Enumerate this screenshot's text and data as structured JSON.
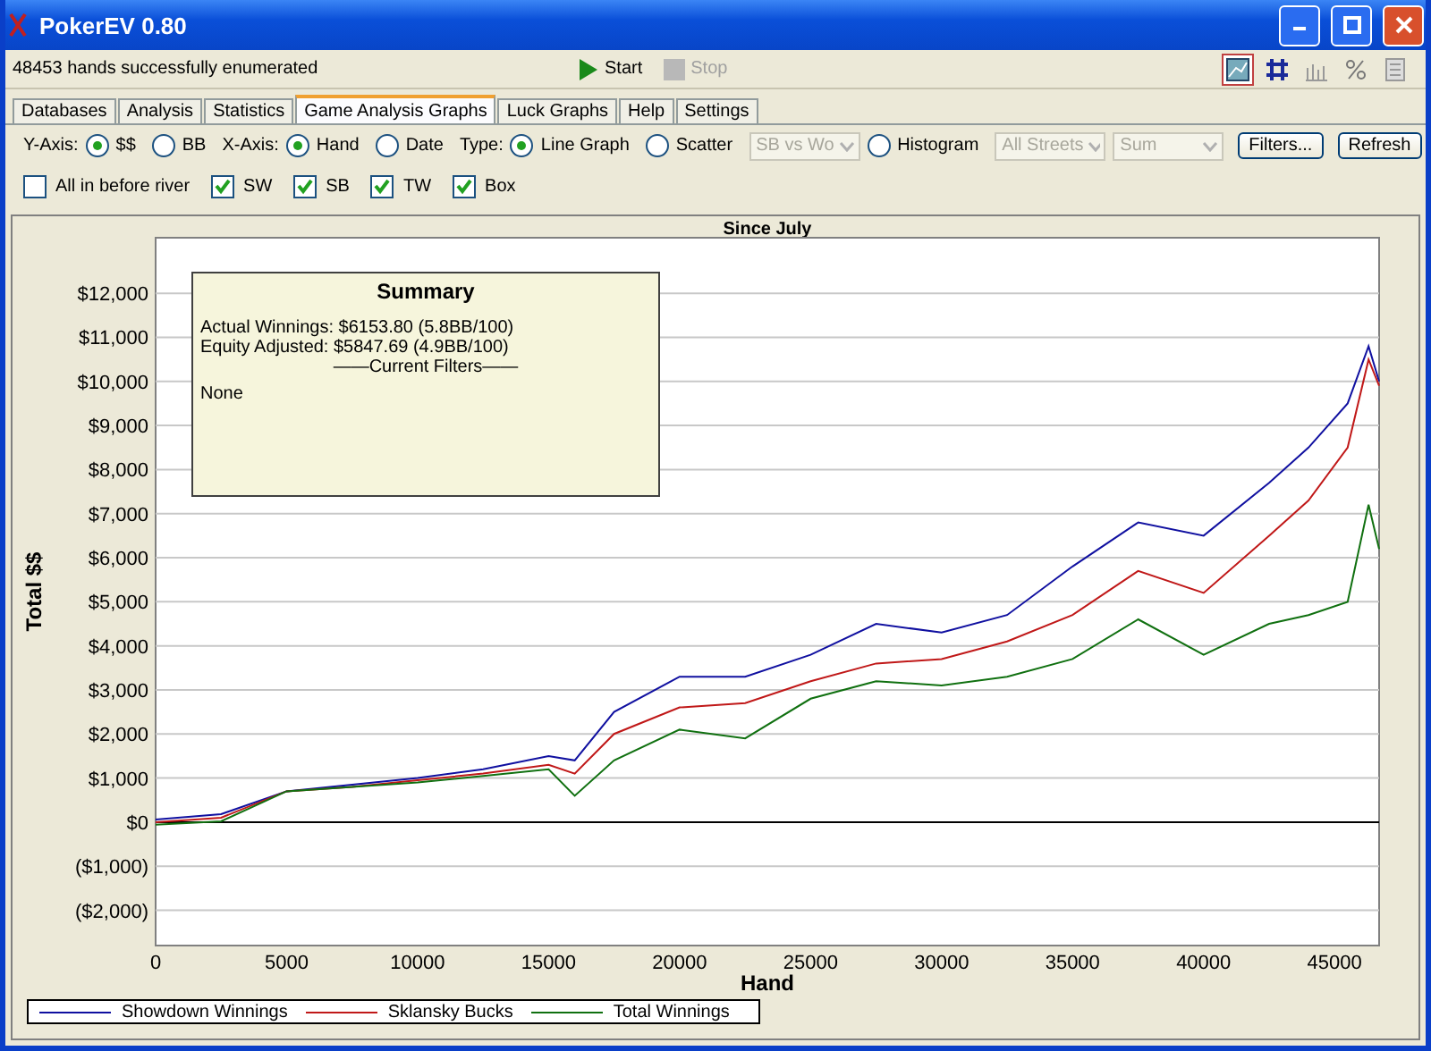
{
  "window": {
    "title": "PokerEV 0.80"
  },
  "toolbar": {
    "status": "48453 hands successfully enumerated",
    "actions": [
      {
        "label": "Start",
        "disabled": false
      },
      {
        "label": "Stop",
        "disabled": true
      }
    ],
    "views": [
      {
        "kind": "chart",
        "selected": true
      },
      {
        "kind": "grid",
        "selected": false
      },
      {
        "kind": "bars",
        "selected": false
      },
      {
        "kind": "percent",
        "selected": false
      },
      {
        "kind": "doc",
        "selected": false
      }
    ]
  },
  "tabs": [
    {
      "label": "Databases",
      "selected": false
    },
    {
      "label": "Analysis",
      "selected": false
    },
    {
      "label": "Statistics",
      "selected": false
    },
    {
      "label": "Game Analysis Graphs",
      "selected": true
    },
    {
      "label": "Luck Graphs",
      "selected": false
    },
    {
      "label": "Help",
      "selected": false
    },
    {
      "label": "Settings",
      "selected": false
    }
  ],
  "options": [
    {
      "kind": "label",
      "label": "Y-Axis:"
    },
    {
      "kind": "radio",
      "label": "$$",
      "selected": true
    },
    {
      "kind": "radio",
      "label": "BB",
      "selected": false
    },
    {
      "kind": "label",
      "label": "X-Axis:"
    },
    {
      "kind": "radio",
      "label": "Hand",
      "selected": true
    },
    {
      "kind": "radio",
      "label": "Date",
      "selected": false
    },
    {
      "kind": "label",
      "label": "Type:"
    },
    {
      "kind": "radio",
      "label": "Line Graph",
      "selected": true
    },
    {
      "kind": "radio",
      "label": "Scatter",
      "selected": false
    },
    {
      "kind": "select",
      "label": "SB vs Wo",
      "disabled": true
    },
    {
      "kind": "radio",
      "label": "Histogram",
      "selected": false
    },
    {
      "kind": "select",
      "label": "All Streets",
      "disabled": true
    },
    {
      "kind": "select",
      "label": "Sum",
      "disabled": true
    },
    {
      "kind": "button",
      "label": "Filters..."
    },
    {
      "kind": "button",
      "label": "Refresh"
    }
  ],
  "checkboxes": [
    {
      "label": "All in before river",
      "checked": false
    },
    {
      "label": "SW",
      "checked": true
    },
    {
      "label": "SB",
      "checked": true
    },
    {
      "label": "TW",
      "checked": true
    },
    {
      "label": "Box",
      "checked": true
    }
  ],
  "summary": {
    "title": "Summary",
    "lines": [
      "Actual Winnings: $6153.80 (5.8BB/100)",
      "Equity Adjusted: $5847.69 (4.9BB/100)"
    ],
    "filters_heading": "——Current Filters——",
    "filters": "None"
  },
  "chart_data": {
    "type": "line",
    "grid": true,
    "title": "Since July",
    "xlabel": "Hand",
    "ylabel": "Total $$",
    "xlim": [
      0,
      46700
    ],
    "ylim": [
      -2800,
      13260
    ],
    "xticks": [
      0,
      5000,
      10000,
      15000,
      20000,
      25000,
      30000,
      35000,
      40000,
      45000
    ],
    "yticks": [
      {
        "value": -2000,
        "label": "($2,000)"
      },
      {
        "value": -1000,
        "label": "($1,000)"
      },
      {
        "value": 0,
        "label": "$0"
      },
      {
        "value": 1000,
        "label": "$1,000"
      },
      {
        "value": 2000,
        "label": "$2,000"
      },
      {
        "value": 3000,
        "label": "$3,000"
      },
      {
        "value": 4000,
        "label": "$4,000"
      },
      {
        "value": 5000,
        "label": "$5,000"
      },
      {
        "value": 6000,
        "label": "$6,000"
      },
      {
        "value": 7000,
        "label": "$7,000"
      },
      {
        "value": 8000,
        "label": "$8,000"
      },
      {
        "value": 9000,
        "label": "$9,000"
      },
      {
        "value": 10000,
        "label": "$10,000"
      },
      {
        "value": 11000,
        "label": "$11,000"
      },
      {
        "value": 12000,
        "label": "$12,000"
      }
    ],
    "x": [
      0,
      2500,
      5000,
      7500,
      10000,
      12500,
      15000,
      16000,
      17500,
      20000,
      22500,
      25000,
      27500,
      30000,
      32500,
      35000,
      37500,
      40000,
      42500,
      44000,
      45500,
      46300,
      46700
    ],
    "series": [
      {
        "name": "Showdown Winnings",
        "color": "#1010a0",
        "values": [
          60,
          180,
          700,
          850,
          1000,
          1200,
          1500,
          1400,
          2500,
          3300,
          3300,
          3800,
          4500,
          4300,
          4700,
          5800,
          6800,
          6500,
          7700,
          8500,
          9500,
          10800,
          10000
        ]
      },
      {
        "name": "Sklansky Bucks",
        "color": "#c01818",
        "values": [
          0,
          100,
          700,
          800,
          950,
          1100,
          1300,
          1100,
          2000,
          2600,
          2700,
          3200,
          3600,
          3700,
          4100,
          4700,
          5700,
          5200,
          6500,
          7300,
          8500,
          10500,
          9900
        ]
      },
      {
        "name": "Total Winnings",
        "color": "#107010",
        "values": [
          -60,
          20,
          700,
          800,
          900,
          1050,
          1200,
          600,
          1400,
          2100,
          1900,
          2800,
          3200,
          3100,
          3300,
          3700,
          4600,
          3800,
          4500,
          4700,
          5000,
          7200,
          6200
        ]
      }
    ]
  }
}
